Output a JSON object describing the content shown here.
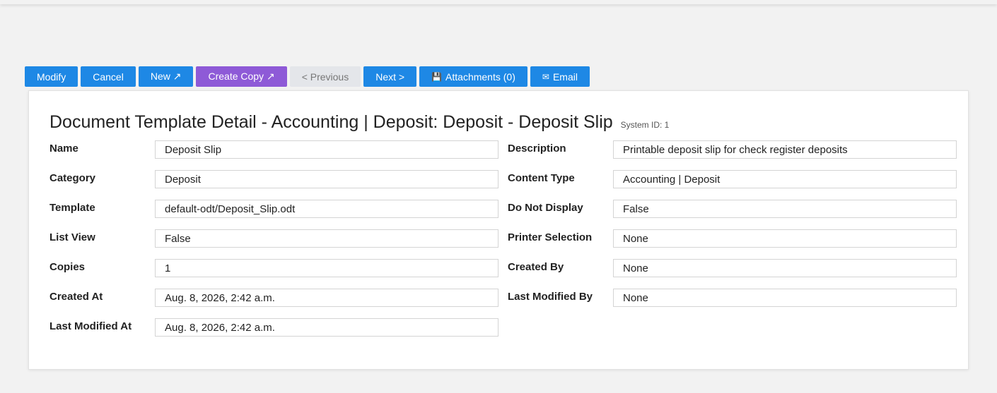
{
  "toolbar": {
    "modify": "Modify",
    "cancel": "Cancel",
    "new": "New ↗",
    "create_copy": "Create Copy ↗",
    "previous": "< Previous",
    "next": "Next >",
    "attachments": "Attachments (0)",
    "email": "Email"
  },
  "detail": {
    "title": "Document Template Detail - Accounting | Deposit: Deposit - Deposit Slip",
    "system_id": "System ID: 1",
    "fields": {
      "name": {
        "label": "Name",
        "value": "Deposit Slip"
      },
      "description": {
        "label": "Description",
        "value": "Printable deposit slip for check register deposits"
      },
      "category": {
        "label": "Category",
        "value": "Deposit"
      },
      "content_type": {
        "label": "Content Type",
        "value": "Accounting | Deposit"
      },
      "template": {
        "label": "Template",
        "value": "default-odt/Deposit_Slip.odt"
      },
      "do_not_display": {
        "label": "Do Not Display",
        "value": "False"
      },
      "list_view": {
        "label": "List View",
        "value": "False"
      },
      "printer_selection": {
        "label": "Printer Selection",
        "value": "None"
      },
      "copies": {
        "label": "Copies",
        "value": "1"
      },
      "created_by": {
        "label": "Created By",
        "value": "None"
      },
      "created_at": {
        "label": "Created At",
        "value": "Aug. 8, 2026, 2:42 a.m."
      },
      "last_modified_by": {
        "label": "Last Modified By",
        "value": "None"
      },
      "last_modified_at": {
        "label": "Last Modified At",
        "value": "Aug. 8, 2026, 2:42 a.m."
      }
    }
  },
  "colors": {
    "primary_button": "#1e88e5",
    "copy_button": "#8e5ad7",
    "disabled_button": "#e4e6ea",
    "background": "#f2f2f2"
  }
}
